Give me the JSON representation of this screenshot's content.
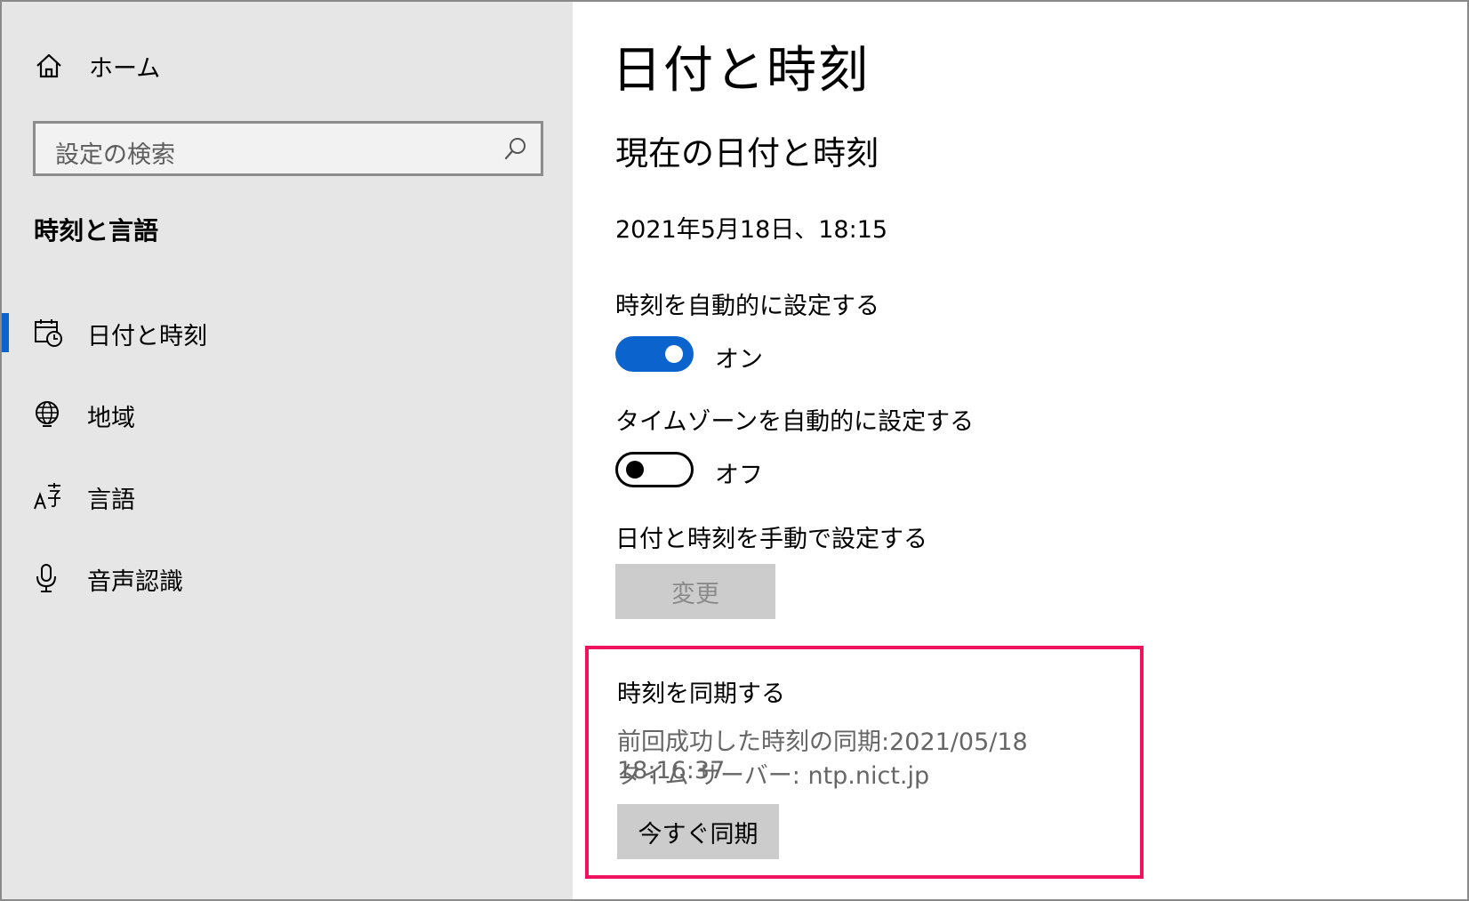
{
  "sidebar": {
    "home_label": "ホーム",
    "search_placeholder": "設定の検索",
    "section_title": "時刻と言語",
    "items": [
      {
        "label": "日付と時刻",
        "icon": "calendar-clock-icon",
        "selected": true
      },
      {
        "label": "地域",
        "icon": "globe-icon",
        "selected": false
      },
      {
        "label": "言語",
        "icon": "language-icon",
        "selected": false
      },
      {
        "label": "音声認識",
        "icon": "microphone-icon",
        "selected": false
      }
    ]
  },
  "main": {
    "title": "日付と時刻",
    "subtitle": "現在の日付と時刻",
    "current_datetime": "2021年5月18日、18:15",
    "auto_time": {
      "label": "時刻を自動的に設定する",
      "state": "オン",
      "on": true
    },
    "auto_timezone": {
      "label": "タイムゾーンを自動的に設定する",
      "state": "オフ",
      "on": false
    },
    "manual": {
      "label": "日付と時刻を手動で設定する",
      "button": "変更"
    },
    "sync": {
      "title": "時刻を同期する",
      "last_sync": "前回成功した時刻の同期:2021/05/18 18:16:37",
      "server": "タイム サーバー: ntp.nict.jp",
      "button": "今すぐ同期"
    }
  },
  "colors": {
    "accent": "#0b63ce",
    "highlight_border": "#f0125e",
    "sidebar_bg": "#e6e6e6"
  }
}
